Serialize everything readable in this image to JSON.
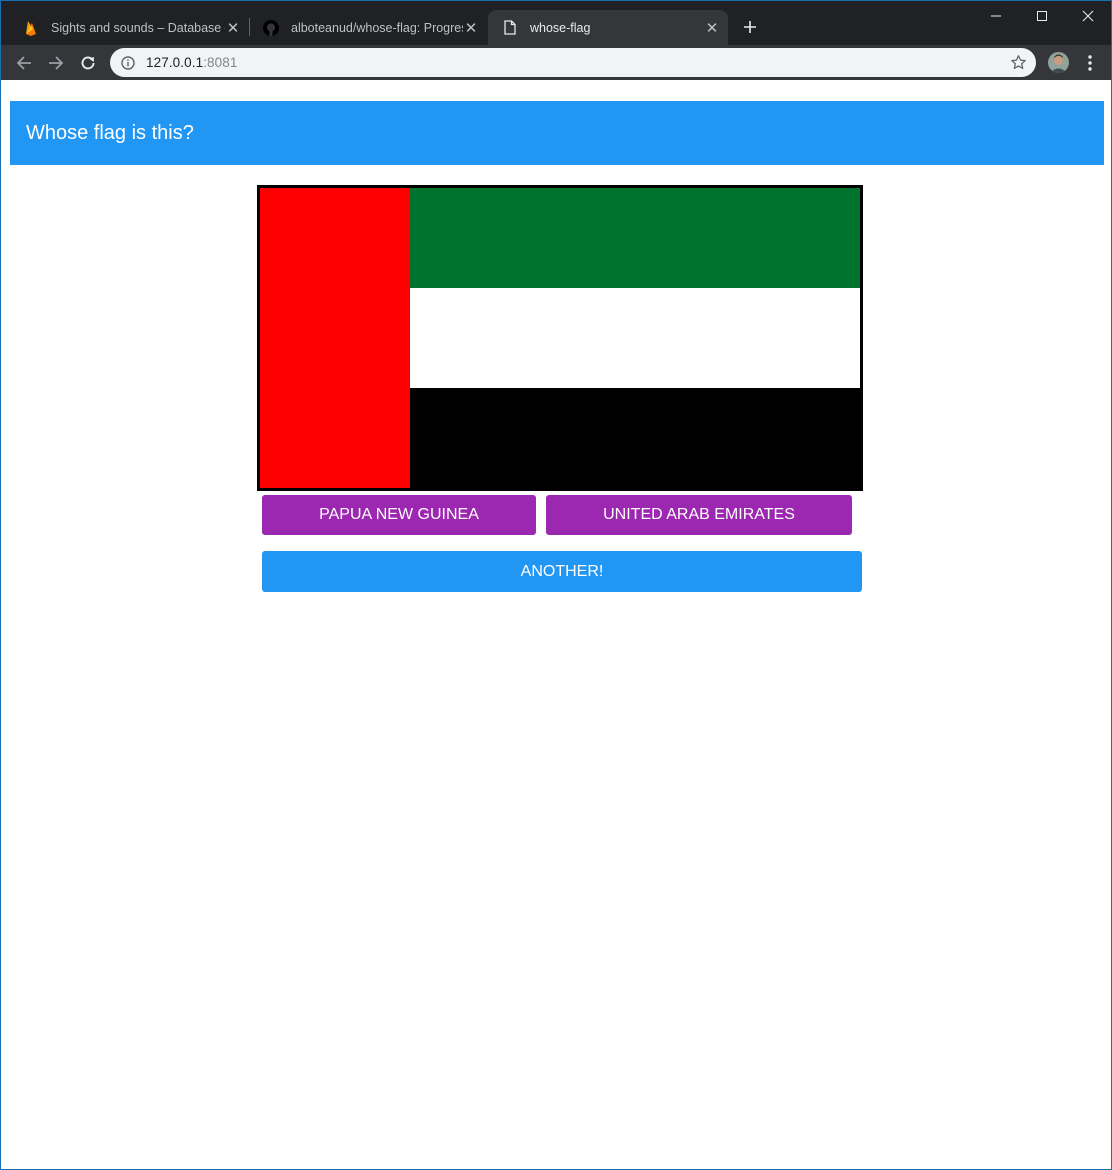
{
  "browser": {
    "tabs": [
      {
        "title": "Sights and sounds – Database – Firebase",
        "icon": "firebase-icon",
        "active": false
      },
      {
        "title": "alboteanud/whose-flag: Progressive",
        "icon": "github-icon",
        "active": false
      },
      {
        "title": "whose-flag",
        "icon": "page-icon",
        "active": true
      }
    ],
    "url_host": "127.0.0.1",
    "url_port": ":8081"
  },
  "app": {
    "title": "Whose flag is this?",
    "flag_colors": {
      "hoist": "#ff0000",
      "top": "#00732f",
      "middle": "#ffffff",
      "bottom": "#000000"
    },
    "answers": [
      "Papua New Guinea",
      "United Arab Emirates"
    ],
    "another_label": "Another!",
    "colors": {
      "header": "#2196f3",
      "answer_button": "#9c27b0",
      "another_button": "#2196f3"
    }
  }
}
